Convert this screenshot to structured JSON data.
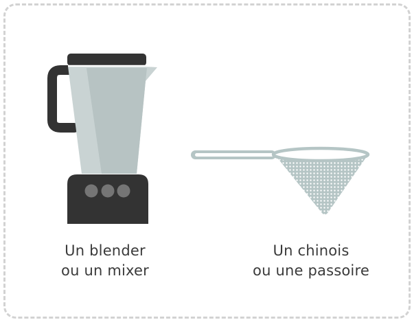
{
  "items": [
    {
      "icon": "blender-icon",
      "line1": "Un blender",
      "line2": "ou un mixer"
    },
    {
      "icon": "chinois-strainer-icon",
      "line1": "Un chinois",
      "line2": "ou une passoire"
    }
  ],
  "colors": {
    "border": "#d2d2d2",
    "appliance_dark": "#333333",
    "jar_light": "#c9d3d3",
    "jar_shade": "#b7c3c3",
    "base_buttons": "#757575",
    "strainer_mesh": "#b5c5c5",
    "text": "#3a3a3a"
  }
}
